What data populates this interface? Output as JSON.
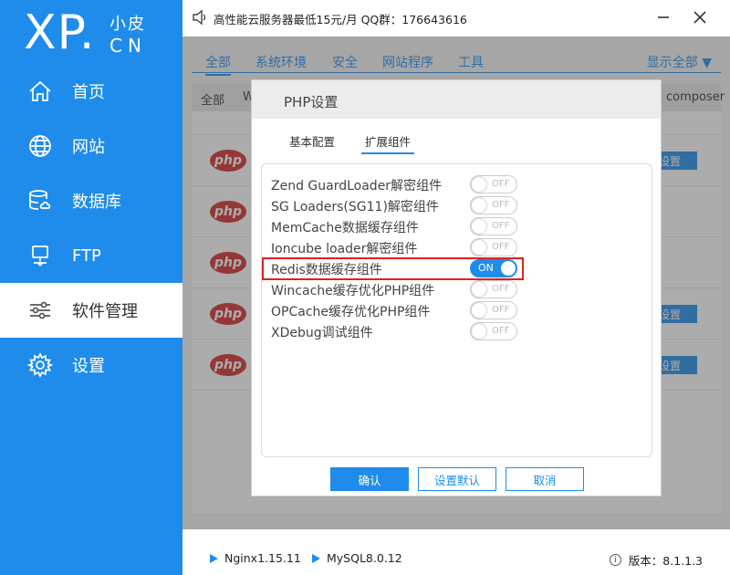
{
  "logo": {
    "main": "XP.",
    "sub_cn": "小皮",
    "sub_en": "CN"
  },
  "sidebar": {
    "items": [
      {
        "label": "首页",
        "icon": "home-icon"
      },
      {
        "label": "网站",
        "icon": "globe-icon"
      },
      {
        "label": "数据库",
        "icon": "database-icon"
      },
      {
        "label": "FTP",
        "icon": "monitor-icon"
      },
      {
        "label": "软件管理",
        "icon": "sliders-icon",
        "active": true
      },
      {
        "label": "设置",
        "icon": "gear-icon"
      }
    ]
  },
  "topbar": {
    "notice": "高性能云服务器最低15元/月  QQ群：176643616",
    "minimize_icon": "minimize-icon",
    "close_icon": "close-icon"
  },
  "main": {
    "tabs": [
      {
        "label": "全部",
        "active": true
      },
      {
        "label": "系统环境"
      },
      {
        "label": "安全"
      },
      {
        "label": "网站程序"
      },
      {
        "label": "工具"
      }
    ],
    "show_all": "显示全部 ▼",
    "table_headers": [
      "全部",
      "W",
      "composer"
    ],
    "row_logo": "php",
    "row_button": "设置"
  },
  "dialog": {
    "title": "PHP设置",
    "tabs": [
      {
        "label": "基本配置"
      },
      {
        "label": "扩展组件",
        "active": true
      }
    ],
    "extensions": [
      {
        "name": "Zend GuardLoader解密组件",
        "state": "OFF"
      },
      {
        "name": "SG Loaders(SG11)解密组件",
        "state": "OFF"
      },
      {
        "name": "MemCache数据缓存组件",
        "state": "OFF"
      },
      {
        "name": "Ioncube loader解密组件",
        "state": "OFF"
      },
      {
        "name": "Redis数据缓存组件",
        "state": "ON"
      },
      {
        "name": "Wincache缓存优化PHP组件",
        "state": "OFF"
      },
      {
        "name": "OPCache缓存优化PHP组件",
        "state": "OFF"
      },
      {
        "name": "XDebug调试组件",
        "state": "OFF"
      }
    ],
    "buttons": {
      "confirm": "确认",
      "reset": "设置默认",
      "cancel": "取消"
    }
  },
  "statusbar": {
    "services": [
      {
        "name": "Nginx1.15.11"
      },
      {
        "name": "MySQL8.0.12"
      }
    ],
    "version_label": "版本：8.1.1.3",
    "info_icon": "info-icon"
  },
  "colors": {
    "accent": "#1f8ceb",
    "highlight": "#e02020",
    "php_red": "#d32a2a"
  }
}
